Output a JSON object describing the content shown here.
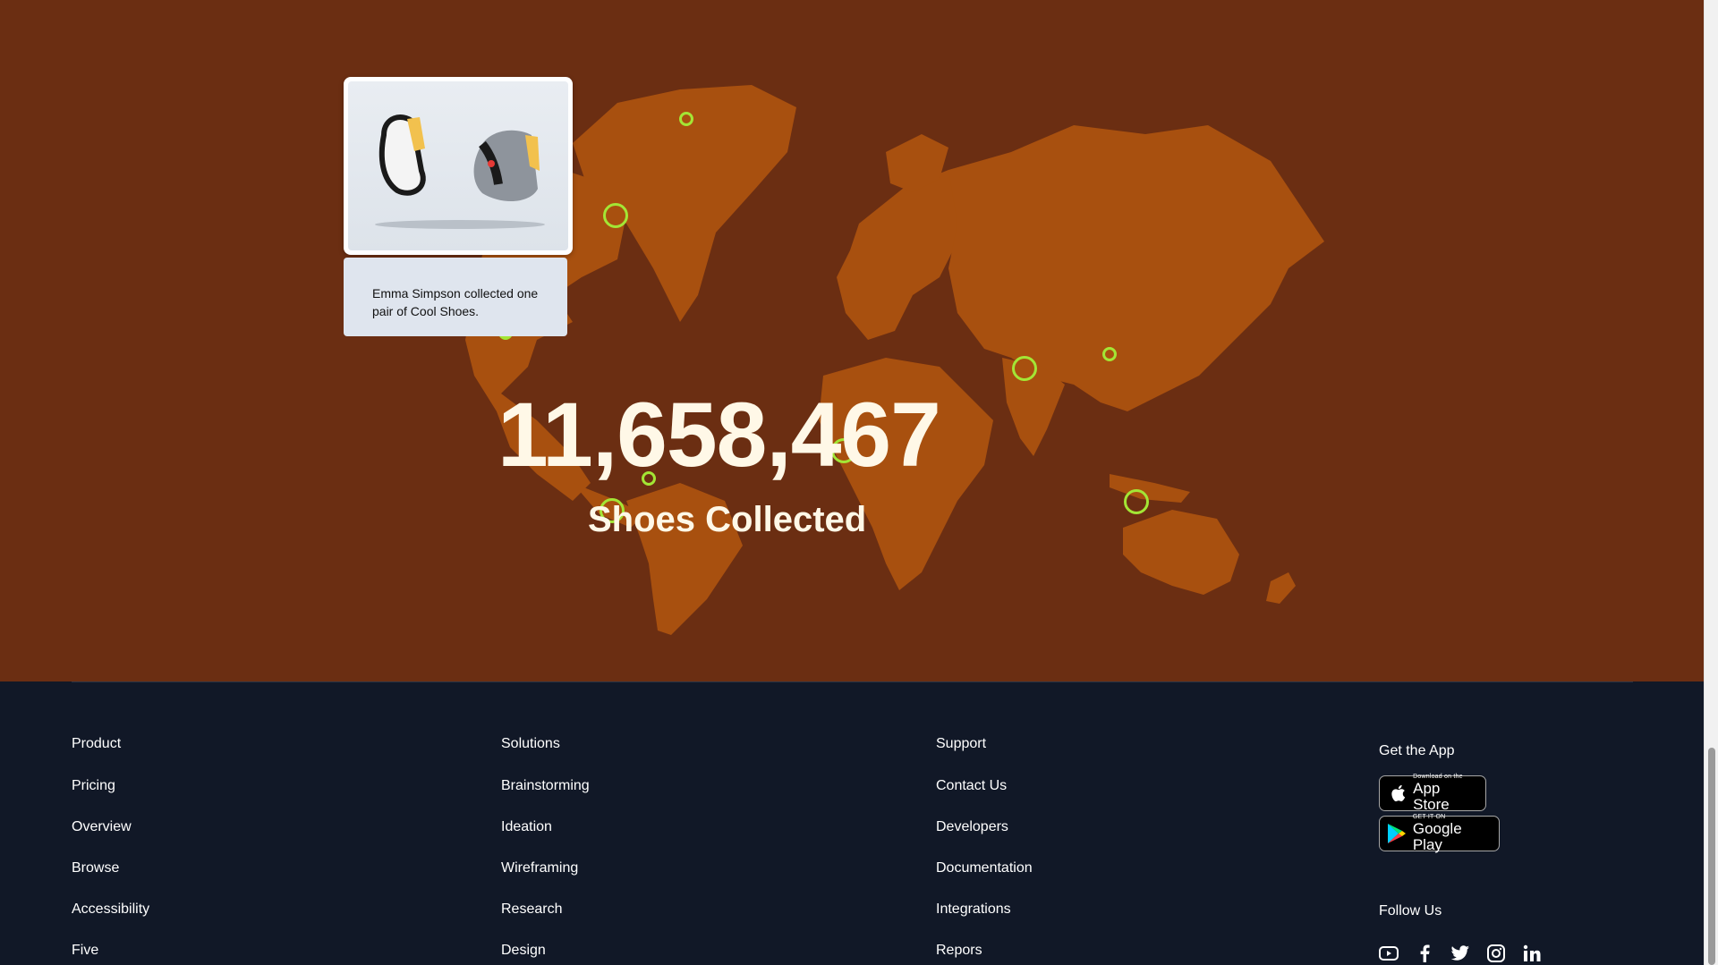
{
  "hero": {
    "counter": "11,658,467",
    "counter_label": "Shoes Collected",
    "popup": {
      "text": "Emma Simpson collected one pair of Cool Shoes."
    }
  },
  "colors": {
    "hero_bg": "#6b2e12",
    "land": "#a8500f",
    "marker": "#a3e635",
    "footer_bg": "#111827"
  },
  "footer": {
    "product": {
      "title": "Product",
      "links": [
        "Pricing",
        "Overview",
        "Browse",
        "Accessibility",
        "Five"
      ]
    },
    "solutions": {
      "title": "Solutions",
      "links": [
        "Brainstorming",
        "Ideation",
        "Wireframing",
        "Research",
        "Design"
      ]
    },
    "support": {
      "title": "Support",
      "links": [
        "Contact Us",
        "Developers",
        "Documentation",
        "Integrations",
        "Repors"
      ]
    },
    "app": {
      "title": "Get the App",
      "app_store_small": "Download on the",
      "app_store_big": "App Store",
      "google_play_small": "GET IT ON",
      "google_play_big": "Google Play"
    },
    "follow": "Follow Us",
    "socials": [
      "youtube-icon",
      "facebook-icon",
      "twitter-icon",
      "instagram-icon",
      "linkedin-icon"
    ]
  }
}
